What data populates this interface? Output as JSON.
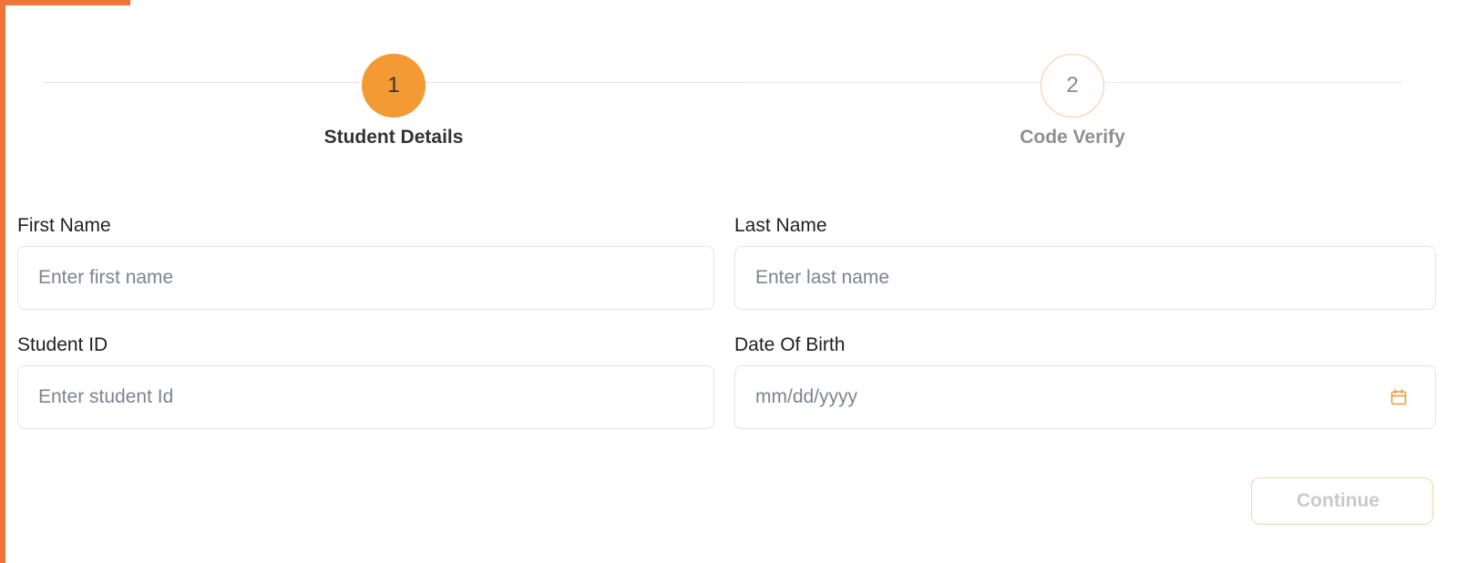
{
  "stepper": {
    "steps": [
      {
        "number": "1",
        "label": "Student Details",
        "state": "active"
      },
      {
        "number": "2",
        "label": "Code Verify",
        "state": "pending"
      }
    ]
  },
  "form": {
    "first_name": {
      "label": "First Name",
      "placeholder": "Enter first name",
      "value": ""
    },
    "last_name": {
      "label": "Last Name",
      "placeholder": "Enter last name",
      "value": ""
    },
    "student_id": {
      "label": "Student ID",
      "placeholder": "Enter student Id",
      "value": ""
    },
    "date_of_birth": {
      "label": "Date Of Birth",
      "placeholder": "mm/dd/yyyy",
      "value": "",
      "icon": "calendar-icon"
    }
  },
  "actions": {
    "continue_label": "Continue",
    "continue_disabled": true
  },
  "colors": {
    "accent": "#ee7439",
    "step_active": "#f39a34",
    "step_pending_border": "#f7c99a",
    "button_border": "#f9d3a8"
  }
}
